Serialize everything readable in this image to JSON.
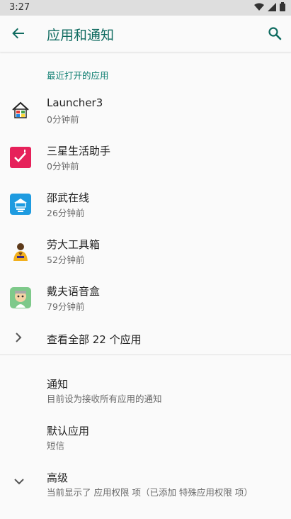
{
  "status_bar": {
    "time": "3:27"
  },
  "app_bar": {
    "title": "应用和通知"
  },
  "recent": {
    "header": "最近打开的应用",
    "apps": [
      {
        "name": "Launcher3",
        "time": "0分钟前",
        "icon": "launcher3-icon"
      },
      {
        "name": "三星生活助手",
        "time": "0分钟前",
        "icon": "samsung-life-assistant-icon"
      },
      {
        "name": "邵武在线",
        "time": "26分钟前",
        "icon": "shaowu-online-icon"
      },
      {
        "name": "劳大工具箱",
        "time": "52分钟前",
        "icon": "lao-da-toolbox-icon"
      },
      {
        "name": "戴夫语音盒",
        "time": "79分钟前",
        "icon": "dave-voice-box-icon"
      }
    ],
    "see_all": "查看全部 22 个应用"
  },
  "settings": {
    "notifications": {
      "title": "通知",
      "summary": "目前设为接收所有应用的通知"
    },
    "default_apps": {
      "title": "默认应用",
      "summary": "短信"
    },
    "advanced": {
      "title": "高级",
      "summary": "当前显示了 应用权限 项（已添加 特殊应用权限 项）"
    }
  },
  "colors": {
    "accent": "#0f7f72",
    "title": "#0f6b60",
    "status_bar": "#dedede"
  }
}
